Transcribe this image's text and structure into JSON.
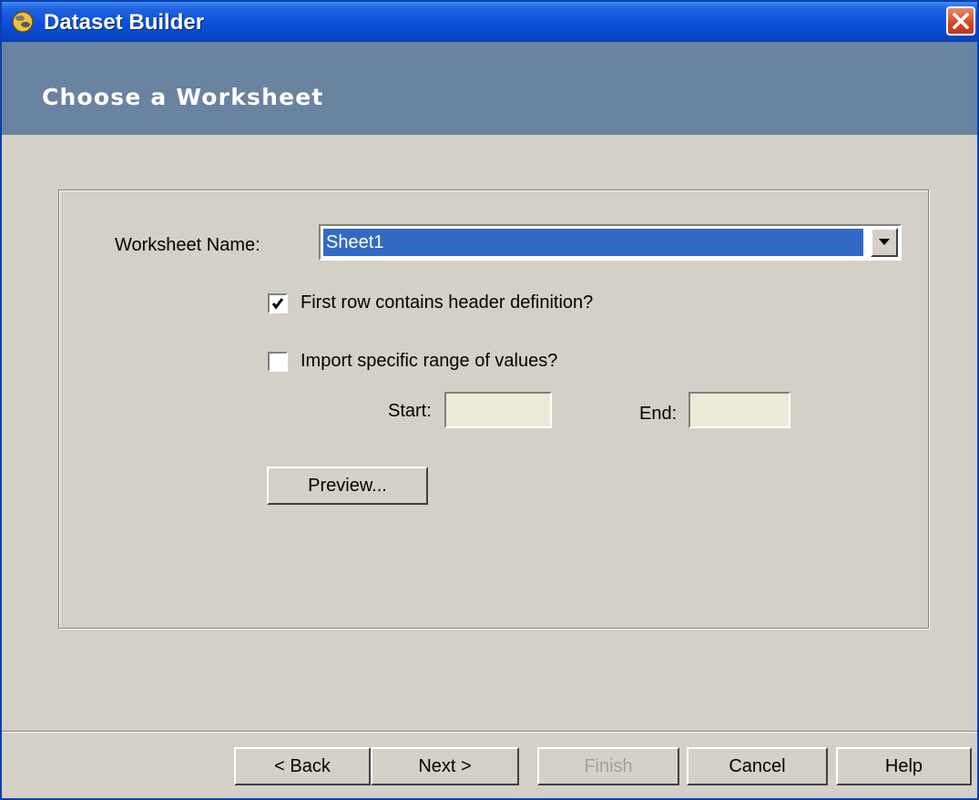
{
  "window": {
    "title": "Dataset Builder"
  },
  "header": {
    "title": "Choose a Worksheet"
  },
  "form": {
    "worksheet_label": "Worksheet Name:",
    "worksheet_value": "Sheet1",
    "first_row_label": "First row contains header definition?",
    "first_row_checked": true,
    "range_label": "Import specific range of values?",
    "range_checked": false,
    "start_label": "Start:",
    "start_value": "",
    "end_label": "End:",
    "end_value": "",
    "preview_label": "Preview..."
  },
  "footer": {
    "back_label": "< Back",
    "next_label": "Next >",
    "finish_label": "Finish",
    "cancel_label": "Cancel",
    "help_label": "Help"
  },
  "icons": {
    "app": "dataset-builder-icon",
    "close": "close-icon",
    "dropdown": "chevron-down-icon",
    "check": "checkmark-icon"
  }
}
